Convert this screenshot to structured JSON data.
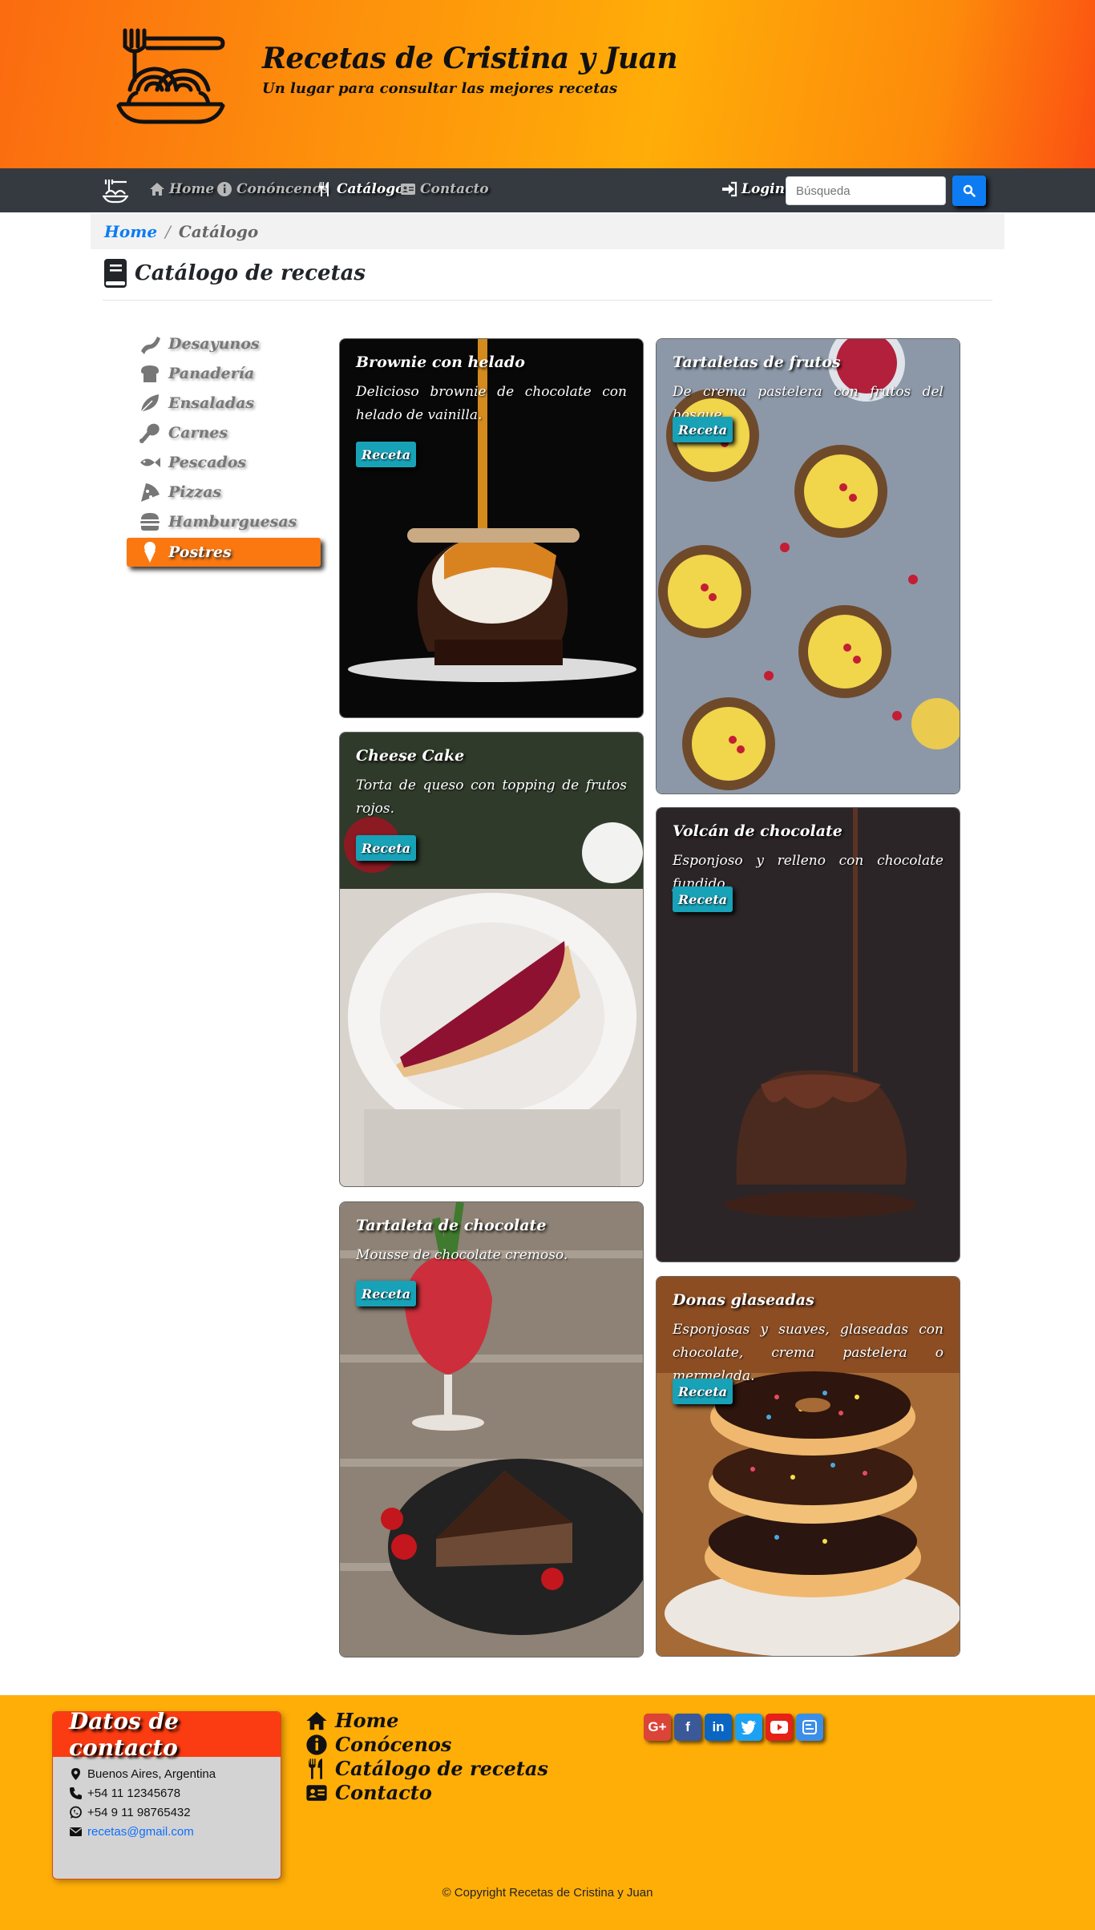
{
  "header": {
    "title": "Recetas de Cristina y Juan",
    "subtitle": "Un lugar para consultar las mejores recetas"
  },
  "nav": {
    "items": [
      {
        "label": "Home",
        "icon": "home-icon"
      },
      {
        "label": "Conóncenos",
        "icon": "info-icon"
      },
      {
        "label": "Catálogo",
        "icon": "utensils-icon",
        "active": true
      },
      {
        "label": "Contacto",
        "icon": "id-card-icon"
      }
    ],
    "login_label": "Login",
    "search_placeholder": "Búsqueda"
  },
  "breadcrumb": {
    "home": "Home",
    "current": "Catálogo"
  },
  "page_title": "Catálogo de recetas",
  "sidebar": {
    "items": [
      {
        "label": "Desayunos",
        "icon": "bacon-icon"
      },
      {
        "label": "Panadería",
        "icon": "bread-icon"
      },
      {
        "label": "Ensaladas",
        "icon": "leaf-icon"
      },
      {
        "label": "Carnes",
        "icon": "drumstick-icon"
      },
      {
        "label": "Pescados",
        "icon": "fish-icon"
      },
      {
        "label": "Pizzas",
        "icon": "pizza-icon"
      },
      {
        "label": "Hamburguesas",
        "icon": "hamburger-icon"
      },
      {
        "label": "Postres",
        "icon": "ice-cream-icon",
        "active": true
      }
    ]
  },
  "recipes": [
    {
      "title": "Brownie con helado",
      "text": "Delicioso brownie de chocolate con helado de vainilla.",
      "button": "Receta"
    },
    {
      "title": "Tartaletas de frutos",
      "text": "De crema pastelera con frutos del bosque.",
      "button": "Receta"
    },
    {
      "title": "Cheese Cake",
      "text": "Torta de queso con topping de frutos rojos.",
      "button": "Receta"
    },
    {
      "title": "Volcán de chocolate",
      "text": "Esponjoso y relleno con chocolate fundido.",
      "button": "Receta"
    },
    {
      "title": "Tartaleta de chocolate",
      "text": "Mousse de chocolate cremoso.",
      "button": "Receta"
    },
    {
      "title": "Donas glaseadas",
      "text": "Esponjosas y suaves, glaseadas con chocolate, crema pastelera o mermelada.",
      "button": "Receta"
    }
  ],
  "footer": {
    "contact_title": "Datos de contacto",
    "address": "Buenos Aires, Argentina",
    "phone": "+54 11 12345678",
    "whatsapp": "+54 9 11 98765432",
    "email": "recetas@gmail.com",
    "links": [
      {
        "label": "Home",
        "icon": "home-icon"
      },
      {
        "label": "Conócenos",
        "icon": "info-icon"
      },
      {
        "label": "Catálogo de recetas",
        "icon": "utensils-icon"
      },
      {
        "label": "Contacto",
        "icon": "id-card-icon"
      }
    ],
    "social": [
      "google-plus-icon",
      "facebook-icon",
      "linkedin-icon",
      "twitter-icon",
      "youtube-icon",
      "blogger-icon"
    ],
    "copyright": "© Copyright Recetas de Cristina y Juan"
  }
}
